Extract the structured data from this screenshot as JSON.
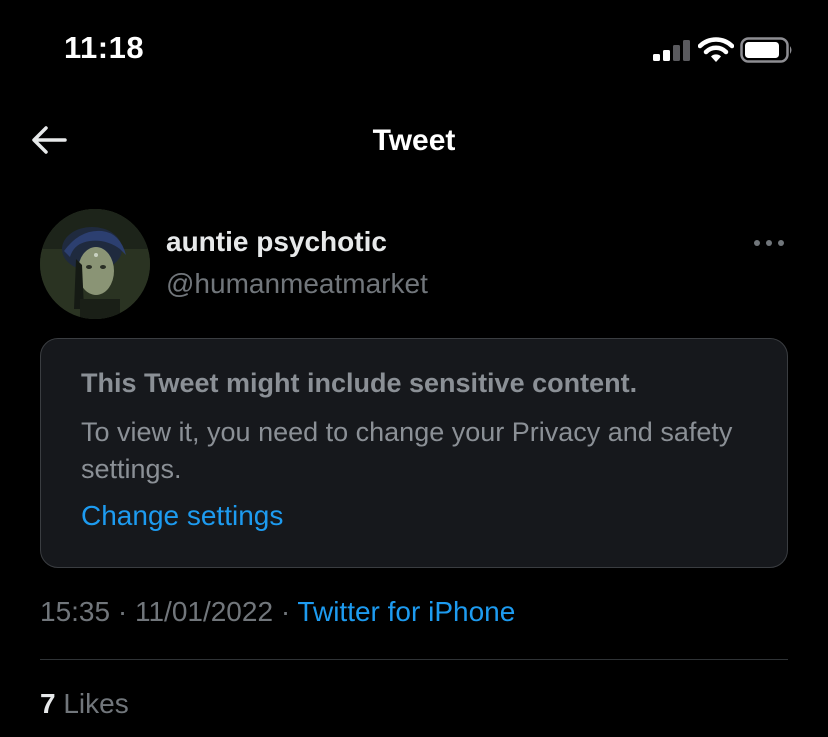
{
  "status_bar": {
    "time": "11:18",
    "signal_icon": "cellular-signal-icon",
    "wifi_icon": "wifi-icon",
    "battery_icon": "battery-icon"
  },
  "nav": {
    "back_icon": "back-arrow-icon",
    "title": "Tweet"
  },
  "tweet": {
    "author": {
      "display_name": "auntie psychotic",
      "handle": "@humanmeatmarket",
      "avatar_icon": "avatar-photo"
    },
    "more_icon": "more-options-icon",
    "sensitive_notice": {
      "title": "This Tweet might include sensitive content.",
      "body": "To view it, you need to change your Privacy and safety settings.",
      "link": "Change settings"
    },
    "meta": {
      "time": "15:35",
      "separator": "·",
      "date": "11/01/2022",
      "source": "Twitter for iPhone"
    },
    "likes": {
      "count": "7",
      "label": "Likes"
    }
  },
  "colors": {
    "background": "#000000",
    "card_background": "#16181c",
    "card_border": "#3a3d41",
    "primary_text": "#e7e9ea",
    "secondary_text": "#71767b",
    "accent": "#1d9bf0"
  }
}
